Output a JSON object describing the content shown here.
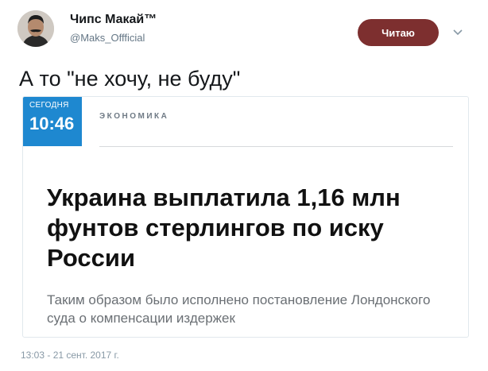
{
  "tweet": {
    "author": {
      "display_name": "Чипс Макай™",
      "handle": "@Maks_Offficial"
    },
    "follow_button_label": "Читаю",
    "text": "А то \"не хочу, не буду\"",
    "timestamp": "13:03 - 21 сент. 2017 г."
  },
  "card": {
    "date_label": "СЕГОДНЯ",
    "time": "10:46",
    "section": "ЭКОНОМИКА",
    "headline": "Украина выплатила 1,16 млн фунтов стерлингов по иску России",
    "lead": "Таким образом было исполнено постановление Лондонского суда о компенсации издержек",
    "badge_color": "#1e88d0"
  },
  "colors": {
    "follow_button": "#7d2f2f",
    "secondary_text": "#657786"
  },
  "icons": {
    "avatar": "user-avatar",
    "caret": "chevron-down-icon"
  }
}
